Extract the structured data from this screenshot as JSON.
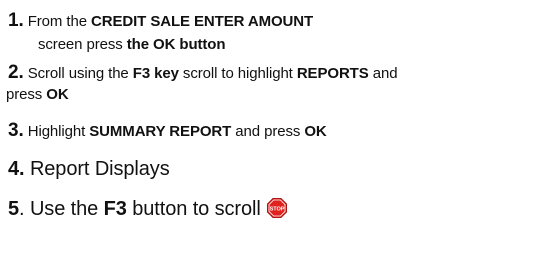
{
  "steps": [
    {
      "number": "1.",
      "parts": [
        " From the ",
        "CREDIT SALE ENTER AMOUNT"
      ],
      "continuation": [
        "screen press ",
        "the OK button"
      ]
    },
    {
      "number": "2.",
      "parts": [
        " Scroll using  the ",
        "F3 key",
        " scroll to highlight ",
        "REPORTS",
        " and"
      ],
      "continuation": [
        "press ",
        "OK"
      ]
    },
    {
      "number": "3.",
      "parts": [
        " Highlight ",
        "SUMMARY REPORT",
        " and press ",
        "OK"
      ]
    },
    {
      "number": "4.",
      "parts": [
        " Report Displays"
      ]
    },
    {
      "number": "5",
      "parts": [
        ".  Use the ",
        "F3",
        " button to scroll"
      ],
      "icon": "stop-sign-icon",
      "icon_text": "STOP"
    }
  ],
  "colors": {
    "stop_red": "#e0231f",
    "text": "#111111"
  }
}
